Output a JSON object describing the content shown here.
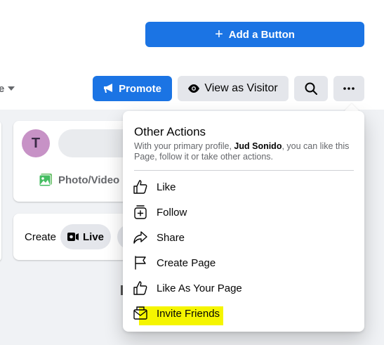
{
  "header": {
    "add_button_plus": "+",
    "add_button_label": "Add a Button",
    "more_dropdown_label": "e"
  },
  "actions": {
    "promote_label": "Promote",
    "view_as_visitor_label": "View as Visitor"
  },
  "composer": {
    "avatar_initial": "T",
    "photo_video_label": "Photo/Video"
  },
  "create": {
    "label": "Create",
    "live_label": "Live"
  },
  "menu": {
    "title": "Other Actions",
    "description_prefix": "With your primary profile, ",
    "description_name": "Jud Sonido",
    "description_suffix": ", you can like this Page, follow it or take other actions.",
    "items": [
      {
        "label": "Like",
        "icon": "thumbs-up-icon"
      },
      {
        "label": "Follow",
        "icon": "follow-icon"
      },
      {
        "label": "Share",
        "icon": "share-icon"
      },
      {
        "label": "Create Page",
        "icon": "flag-icon"
      },
      {
        "label": "Like As Your Page",
        "icon": "thumbs-up-icon"
      },
      {
        "label": "Invite Friends",
        "icon": "envelope-icon",
        "highlighted": true
      }
    ]
  },
  "colors": {
    "primary_blue": "#1b74e4",
    "highlight_yellow": "#f5f500",
    "avatar_purple": "#c792c6"
  }
}
